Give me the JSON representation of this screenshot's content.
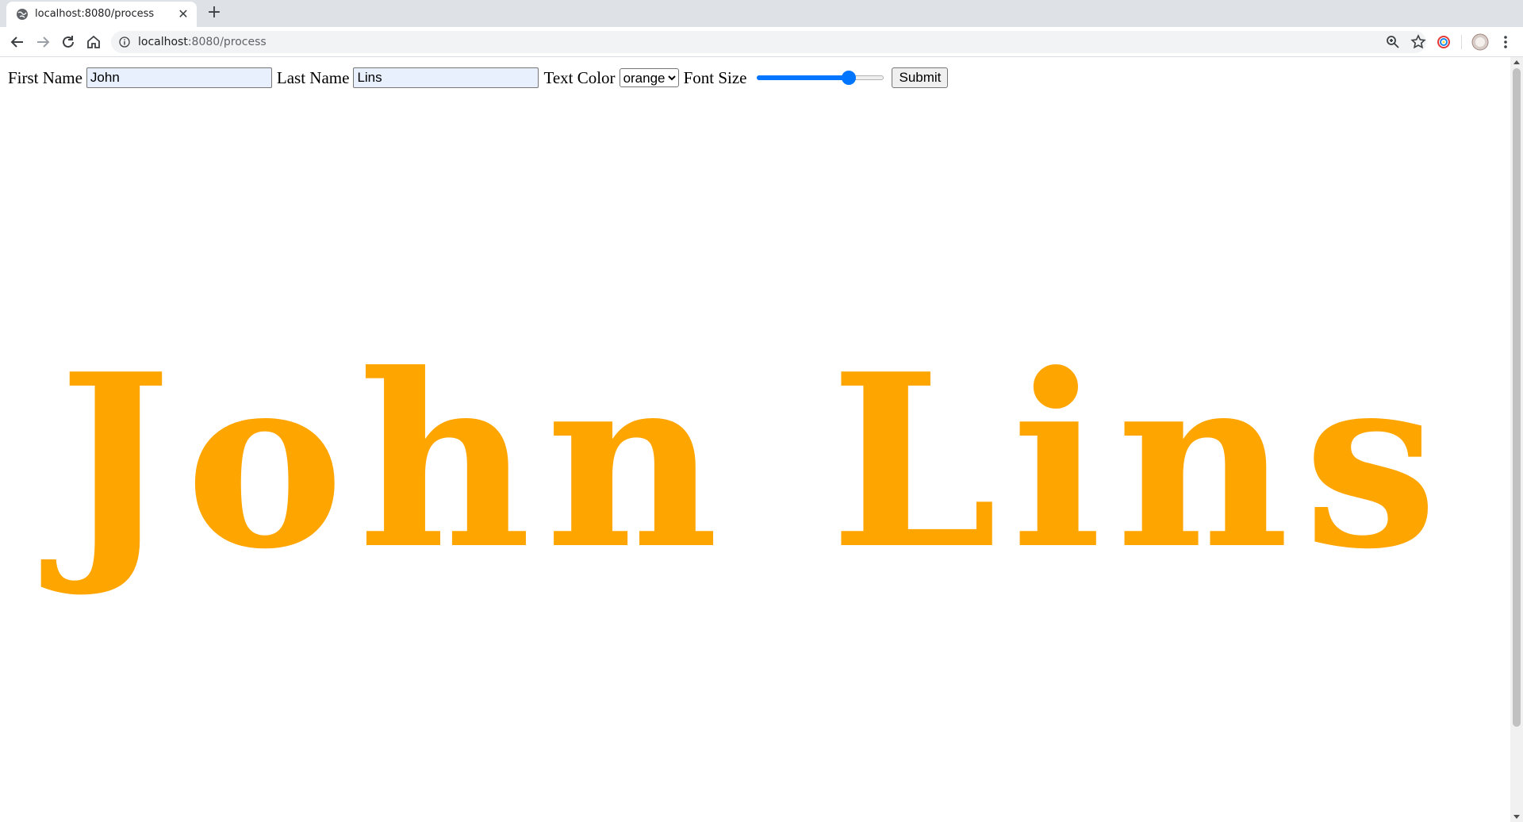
{
  "browser": {
    "tab_title": "localhost:8080/process",
    "url_host": "localhost",
    "url_path": ":8080/process",
    "icons": {
      "favicon": "globe-icon",
      "close": "close-icon",
      "new_tab": "plus-icon",
      "back": "back-arrow-icon",
      "forward": "forward-arrow-icon",
      "reload": "reload-icon",
      "home": "home-icon",
      "site_info": "info-icon",
      "zoom": "zoom-icon",
      "bookmark": "star-icon",
      "extension": "extension-icon",
      "profile": "avatar",
      "menu": "kebab-menu-icon"
    },
    "tab_close_glyph": "✕",
    "new_tab_glyph": "+"
  },
  "form": {
    "first_name_label": "First Name",
    "first_name_value": "John",
    "last_name_label": "Last Name",
    "last_name_value": "Lins",
    "text_color_label": "Text Color",
    "text_color_value": "orange",
    "font_size_label": "Font Size",
    "font_size_fraction": 0.72,
    "submit_label": "Submit"
  },
  "output": {
    "name_text": "John Lins",
    "color": "#ffa500"
  }
}
